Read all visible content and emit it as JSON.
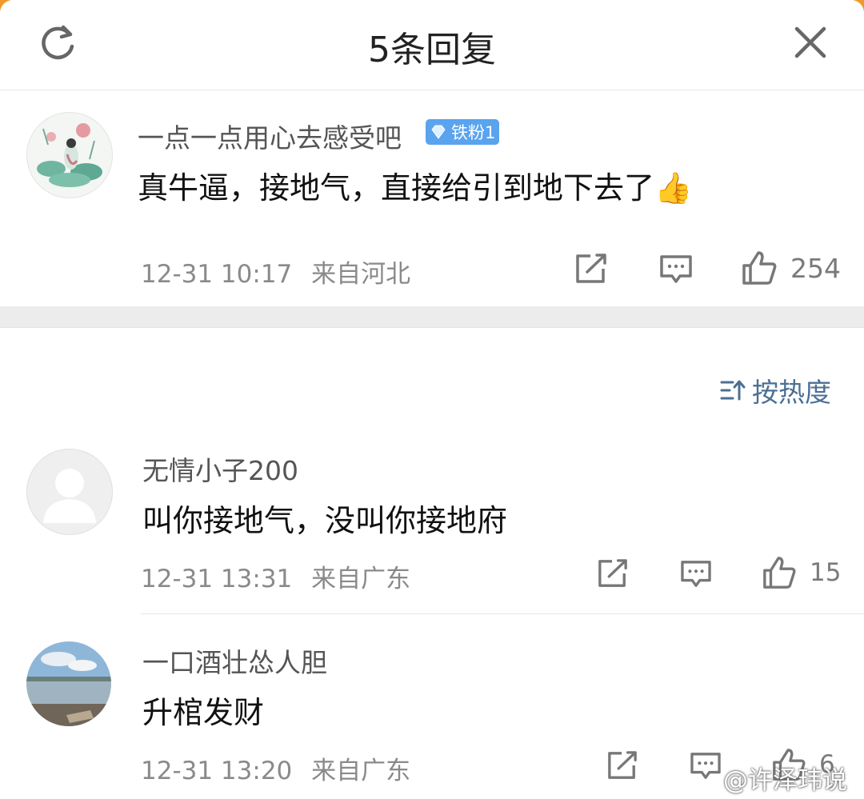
{
  "header": {
    "title": "5条回复",
    "refresh_icon": "refresh-icon",
    "close_icon": "close-icon"
  },
  "main_comment": {
    "username": "一点一点用心去感受吧",
    "badge": "铁粉1",
    "text": "真牛逼，接地气，直接给引到地下去了👍",
    "time": "12-31 10:17",
    "location": "来自河北",
    "likes": "254"
  },
  "sort": {
    "label": "按热度"
  },
  "replies": [
    {
      "username": "无情小子200",
      "text": "叫你接地气，没叫你接地府",
      "time": "12-31 13:31",
      "location": "来自广东",
      "likes": "15"
    },
    {
      "username": "一口酒壮怂人胆",
      "text": "升棺发财",
      "time": "12-31 13:20",
      "location": "来自广东",
      "likes": "6"
    }
  ],
  "watermark": "@许泽玮说",
  "colors": {
    "accent": "#4b6f95",
    "badge": "#5aa3ef",
    "meta": "#8a8a8a",
    "corner": "#ef9a2a"
  }
}
